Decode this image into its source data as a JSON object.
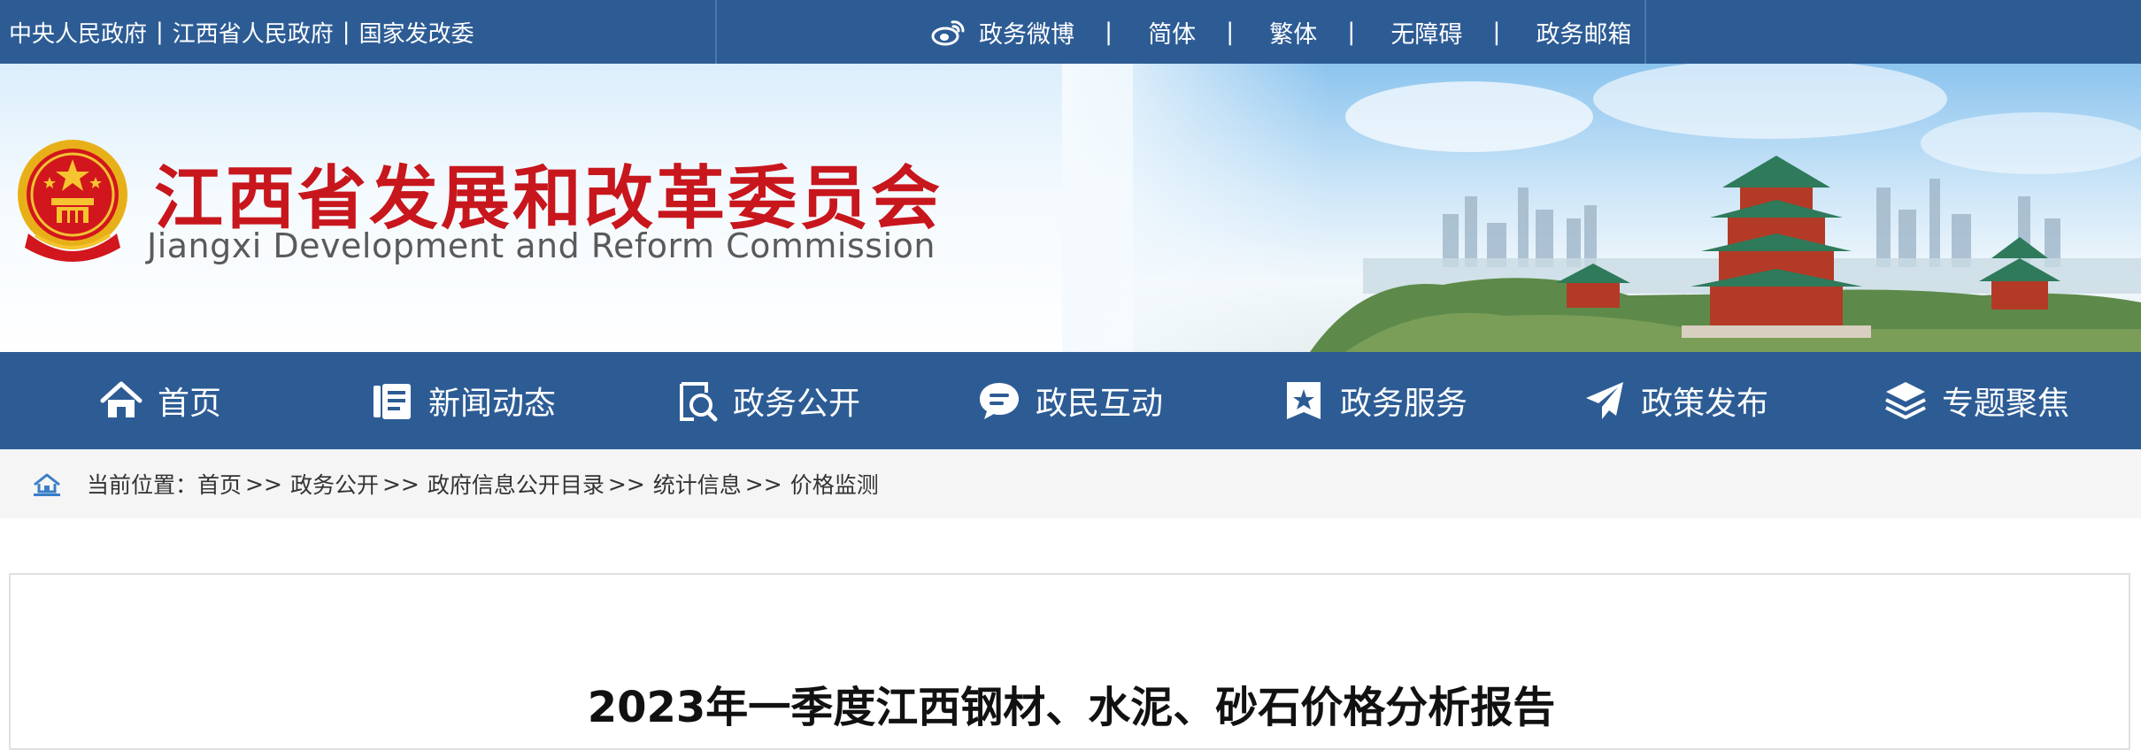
{
  "topbar": {
    "links": [
      "中央人民政府",
      "江西省人民政府",
      "国家发改委"
    ],
    "sep": "|",
    "right": [
      "政务微博",
      "简体",
      "繁体",
      "无障碍",
      "政务邮箱"
    ],
    "pipe": "|"
  },
  "banner": {
    "title_cn": "江西省发展和改革委员会",
    "title_en": "Jiangxi Development and Reform Commission"
  },
  "nav": {
    "items": [
      {
        "label": "首页",
        "icon": "home-icon"
      },
      {
        "label": "新闻动态",
        "icon": "news-icon"
      },
      {
        "label": "政务公开",
        "icon": "search-doc-icon"
      },
      {
        "label": "政民互动",
        "icon": "chat-icon"
      },
      {
        "label": "政务服务",
        "icon": "star-badge-icon"
      },
      {
        "label": "政策发布",
        "icon": "paper-plane-icon"
      },
      {
        "label": "专题聚焦",
        "icon": "layers-icon"
      }
    ]
  },
  "breadcrumb": {
    "prefix": "当前位置：",
    "items": [
      "首页",
      "政务公开",
      "政府信息公开目录",
      "统计信息",
      "价格监测"
    ],
    "sep": ">>"
  },
  "article": {
    "title": "2023年一季度江西钢材、水泥、砂石价格分析报告"
  },
  "colors": {
    "nav_blue": "#2d5c95",
    "title_red": "#c8161d"
  }
}
